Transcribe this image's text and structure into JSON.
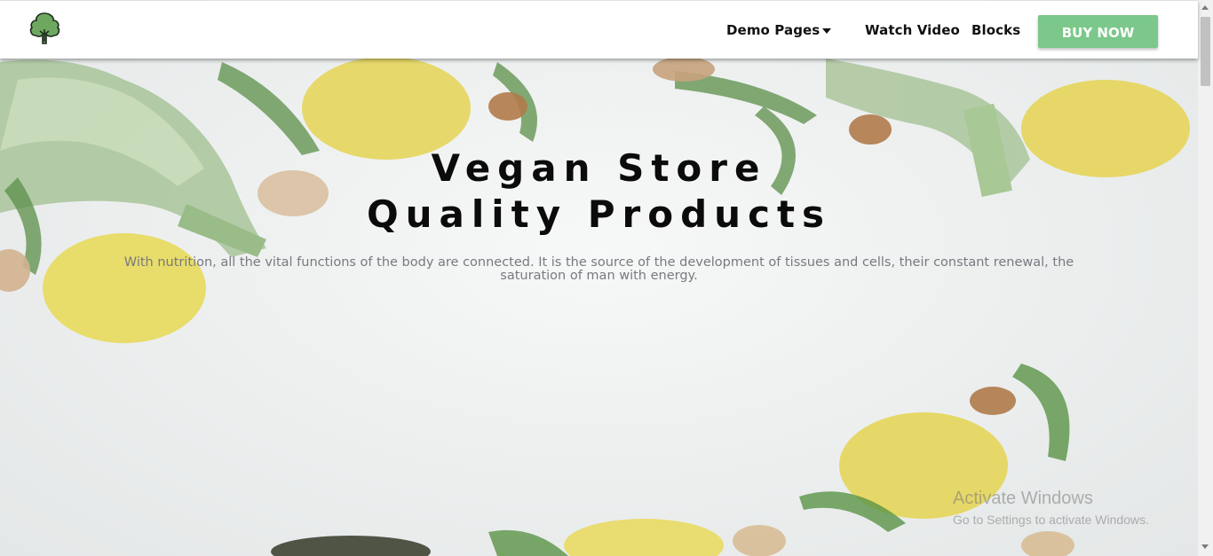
{
  "navbar": {
    "logo_icon": "broccoli-tree-icon",
    "items": [
      {
        "label": "Demo Pages",
        "has_dropdown": true
      },
      {
        "label": "Watch Video"
      },
      {
        "label": "Blocks"
      }
    ],
    "buy_label": "BUY NOW",
    "buy_color": "#7bc88a"
  },
  "hero": {
    "title_line1": "Vegan Store",
    "title_line2": "Quality Products",
    "subtitle": "With nutrition, all the vital functions of the body are connected. It is the source of the development of tissues and cells, their constant renewal, the saturation of man with energy."
  },
  "watermark": {
    "line1": "Activate Windows",
    "line2": "Go to Settings to activate Windows."
  }
}
